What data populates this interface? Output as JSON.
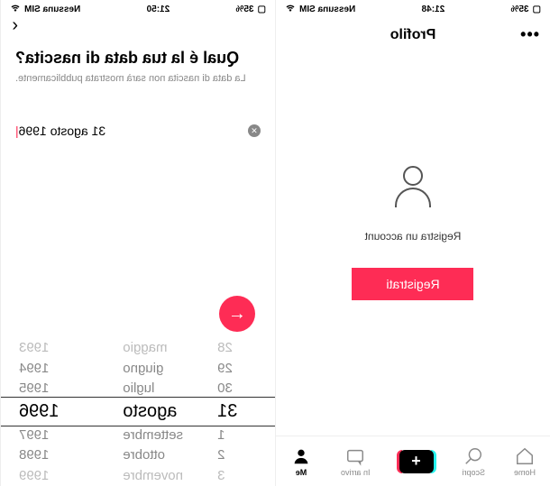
{
  "status": {
    "battery_left": "35%",
    "time_left": "21:48",
    "carrier_left": "Nessuna SIM",
    "battery_right": "35%",
    "time_right": "21:50",
    "carrier_right": "Nessuna SIM"
  },
  "profile": {
    "header_title": "Profilo",
    "register_prompt": "Registra un account",
    "register_button": "Registrati"
  },
  "nav": {
    "home": "Home",
    "discover": "Scopri",
    "inbox": "In arrivo",
    "me": "Me"
  },
  "birthday": {
    "title": "Qual é la tua data di nascita?",
    "subtitle": "La data di nascita non sarà mostrata pubblicamente.",
    "selected_date": "31 agosto 1996",
    "wheel": {
      "days": [
        "28",
        "29",
        "30",
        "31",
        "1",
        "2",
        "3"
      ],
      "months": [
        "maggio",
        "giugno",
        "luglio",
        "agosto",
        "settembre",
        "ottobre",
        "novembre"
      ],
      "years": [
        "1993",
        "1994",
        "1995",
        "1996",
        "1997",
        "1998",
        "1999"
      ]
    }
  }
}
